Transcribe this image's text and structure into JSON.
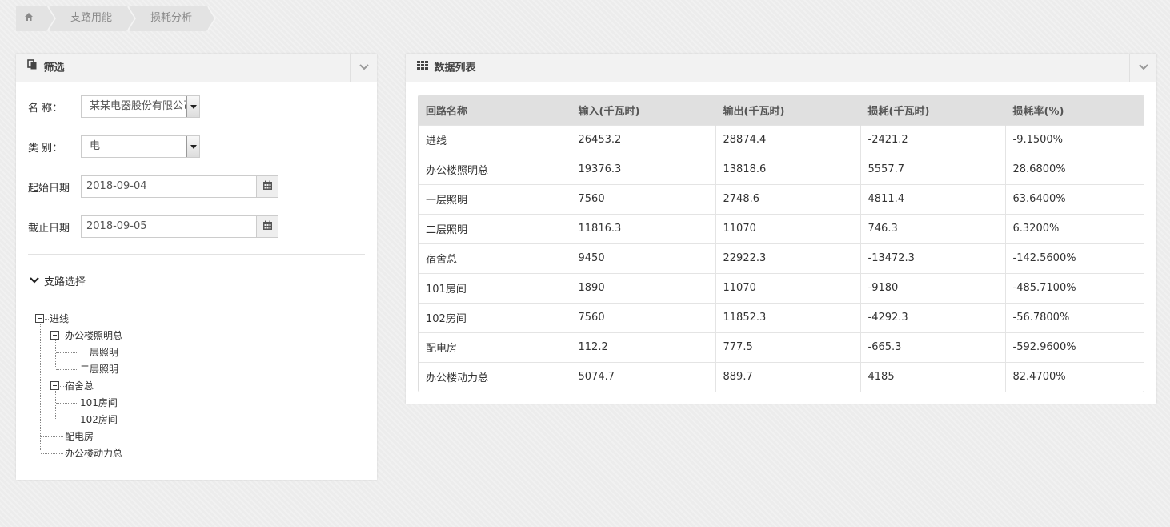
{
  "breadcrumb": {
    "items": [
      "支路用能",
      "损耗分析"
    ]
  },
  "filter_panel": {
    "title": "筛选",
    "name_label": "名 称：",
    "name_value": "某某电器股份有限公司",
    "type_label": "类 别：",
    "type_value": "电",
    "start_label": "起始日期",
    "start_value": "2018-09-04",
    "end_label": "截止日期",
    "end_value": "2018-09-05",
    "tree_title": "支路选择",
    "tree": {
      "root": "进线",
      "n1": "办公楼照明总",
      "n1a": "一层照明",
      "n1b": "二层照明",
      "n2": "宿舍总",
      "n2a": "101房间",
      "n2b": "102房间",
      "n3": "配电房",
      "n4": "办公楼动力总"
    }
  },
  "data_panel": {
    "title": "数据列表",
    "columns": [
      "回路名称",
      "输入(千瓦时)",
      "输出(千瓦时)",
      "损耗(千瓦时)",
      "损耗率(%)"
    ],
    "rows": [
      [
        "进线",
        "26453.2",
        "28874.4",
        "-2421.2",
        "-9.1500%"
      ],
      [
        "办公楼照明总",
        "19376.3",
        "13818.6",
        "5557.7",
        "28.6800%"
      ],
      [
        "一层照明",
        "7560",
        "2748.6",
        "4811.4",
        "63.6400%"
      ],
      [
        "二层照明",
        "11816.3",
        "11070",
        "746.3",
        "6.3200%"
      ],
      [
        "宿舍总",
        "9450",
        "22922.3",
        "-13472.3",
        "-142.5600%"
      ],
      [
        "101房间",
        "1890",
        "11070",
        "-9180",
        "-485.7100%"
      ],
      [
        "102房间",
        "7560",
        "11852.3",
        "-4292.3",
        "-56.7800%"
      ],
      [
        "配电房",
        "112.2",
        "777.5",
        "-665.3",
        "-592.9600%"
      ],
      [
        "办公楼动力总",
        "5074.7",
        "889.7",
        "4185",
        "82.4700%"
      ]
    ]
  },
  "icons": {
    "home": "home-icon",
    "filter": "copy-icon",
    "table": "grid-icon",
    "collapse": "chevron-down-icon",
    "calendar": "calendar-icon"
  }
}
